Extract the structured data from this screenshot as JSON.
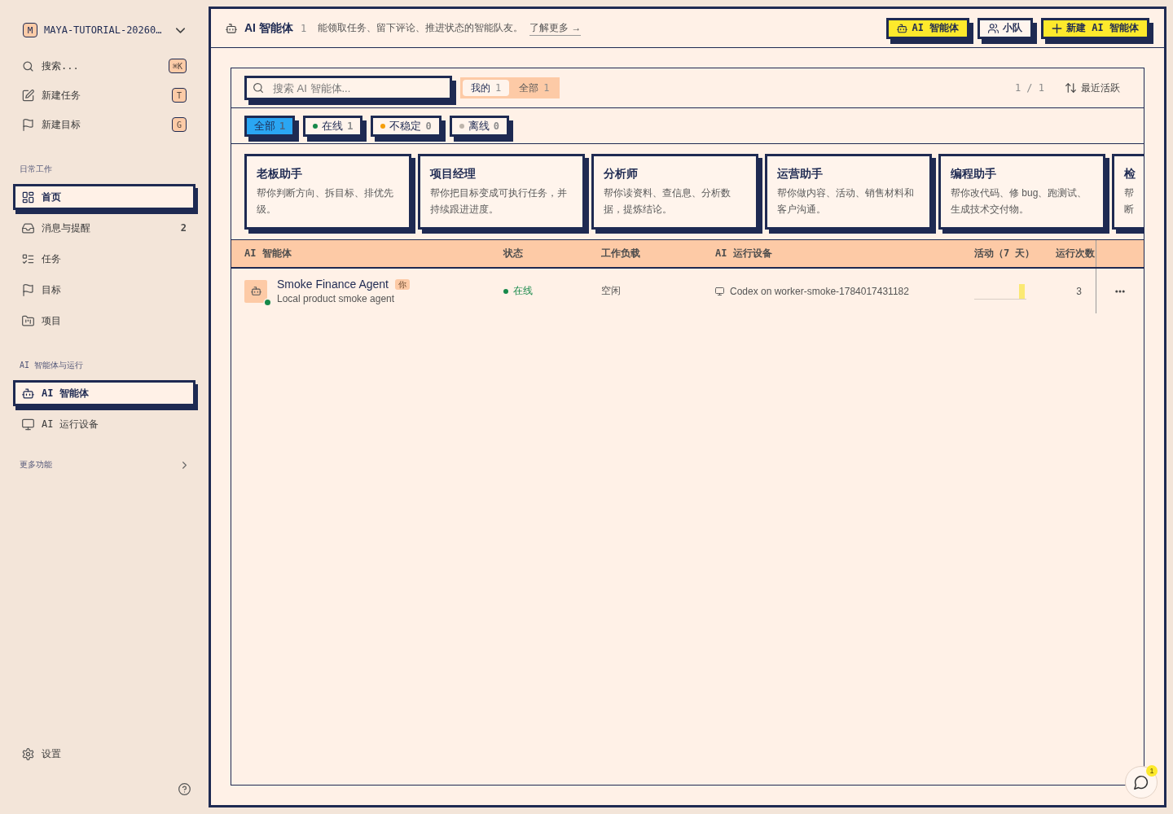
{
  "sidebar": {
    "workspace": {
      "initial": "M",
      "name": "MAYA-TUTORIAL-20260…"
    },
    "quick_actions": [
      {
        "kind": "search",
        "label": "搜索...",
        "shortcut": "⌘K"
      },
      {
        "kind": "new-task",
        "label": "新建任务",
        "shortcut": "T"
      },
      {
        "kind": "new-goal",
        "label": "新建目标",
        "shortcut": "G"
      }
    ],
    "sections": [
      {
        "title": "日常工作",
        "items": [
          {
            "kind": "home",
            "label": "首页",
            "selected": true
          },
          {
            "kind": "inbox",
            "label": "消息与提醒",
            "count": "2",
            "selected": false
          },
          {
            "kind": "tasks",
            "label": "任务",
            "selected": false
          },
          {
            "kind": "goals",
            "label": "目标",
            "selected": false
          },
          {
            "kind": "projects",
            "label": "项目",
            "selected": false
          }
        ]
      },
      {
        "title": "AI 智能体与运行",
        "items": [
          {
            "kind": "agents",
            "label": "AI 智能体",
            "selected": true
          },
          {
            "kind": "devices",
            "label": "AI 运行设备",
            "selected": false
          }
        ]
      }
    ],
    "more": {
      "label": "更多功能",
      "expanded": false
    },
    "settings": {
      "label": "设置"
    }
  },
  "header": {
    "title": "AI 智能体",
    "count": "1",
    "description": "能领取任务、留下评论、推进状态的智能队友。",
    "link": "了解更多 →",
    "view_tabs": [
      {
        "kind": "agents",
        "label": "AI 智能体",
        "selected": true
      },
      {
        "kind": "squads",
        "label": "小队",
        "selected": false
      }
    ],
    "create_button": {
      "label": "新建 AI 智能体"
    }
  },
  "toolbar": {
    "search": {
      "placeholder": "搜索 AI 智能体..."
    },
    "scope_tabs": [
      {
        "label": "我的",
        "count": "1",
        "selected": true
      },
      {
        "label": "全部",
        "count": "1",
        "selected": false
      }
    ],
    "pagination": "1 / 1",
    "sort": "最近活跃"
  },
  "status_filters": [
    {
      "label": "全部",
      "count": "1",
      "selected": true
    },
    {
      "label": "在线",
      "count": "1",
      "selected": false,
      "color": "#16894a"
    },
    {
      "label": "不稳定",
      "count": "0",
      "selected": false,
      "color": "#f59e0b"
    },
    {
      "label": "离线",
      "count": "0",
      "selected": false,
      "color": "#bdb4ab"
    }
  ],
  "templates": [
    {
      "title": "老板助手",
      "lines": [
        "帮你判断方向、拆目标、排优先",
        "级。"
      ]
    },
    {
      "title": "项目经理",
      "lines": [
        "帮你把目标变成可执行任务，并",
        "持续跟进进度。"
      ]
    },
    {
      "title": "分析师",
      "lines": [
        "帮你读资料、查信息、分析数",
        "据，提炼结论。"
      ]
    },
    {
      "title": "运营助手",
      "lines": [
        "帮你做内容、活动、销售材料和",
        "客户沟通。"
      ]
    },
    {
      "title": "编程助手",
      "lines": [
        "帮你改代码、修 bug、跑测试、",
        "生成技术交付物。"
      ]
    },
    {
      "title": "检",
      "lines": [
        "帮",
        "断"
      ]
    }
  ],
  "table": {
    "columns": [
      "AI 智能体",
      "状态",
      "工作负载",
      "AI 运行设备",
      "活动（7 天）",
      "运行次数"
    ],
    "rows": [
      {
        "name": "Smoke Finance Agent",
        "badge": "你",
        "description": "Local product smoke agent",
        "online": true,
        "status": {
          "label": "在线",
          "color": "#16894a"
        },
        "workload": "空闲",
        "device": "Codex on worker-smoke-1784017431182",
        "runs": "3"
      }
    ]
  },
  "chat": {
    "badge": "1"
  }
}
